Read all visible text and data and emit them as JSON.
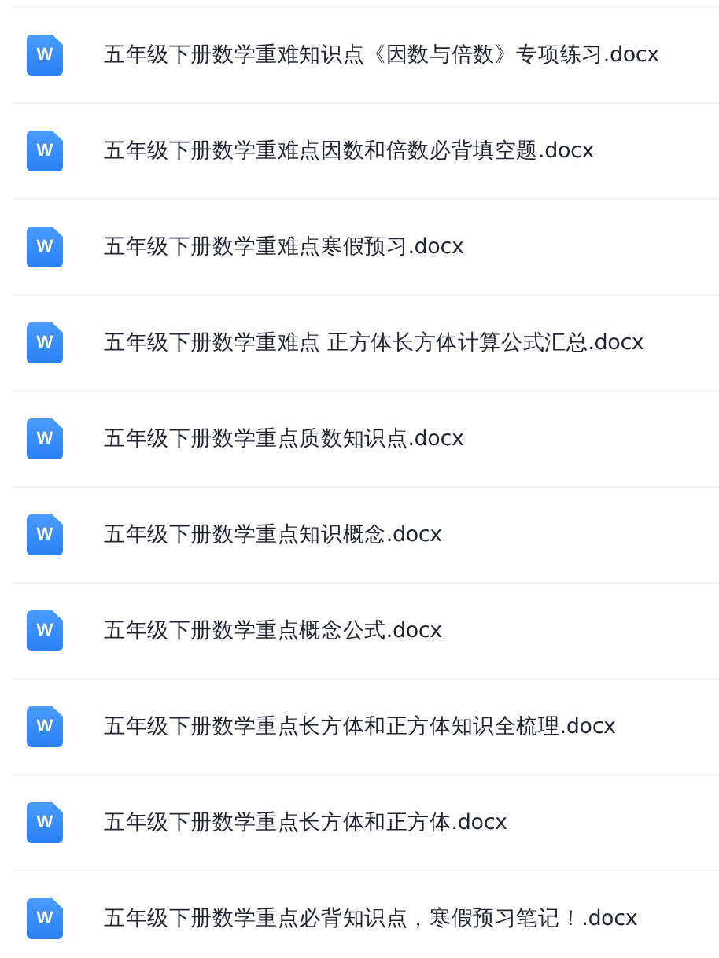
{
  "files": [
    {
      "name": "五年级下册数学重难知识点《因数与倍数》专项练习.docx",
      "icon_letter": "W"
    },
    {
      "name": "五年级下册数学重难点因数和倍数必背填空题.docx",
      "icon_letter": "W"
    },
    {
      "name": "五年级下册数学重难点寒假预习.docx",
      "icon_letter": "W"
    },
    {
      "name": "五年级下册数学重难点 正方体长方体计算公式汇总.docx",
      "icon_letter": "W"
    },
    {
      "name": "五年级下册数学重点质数知识点.docx",
      "icon_letter": "W"
    },
    {
      "name": "五年级下册数学重点知识概念.docx",
      "icon_letter": "W"
    },
    {
      "name": "五年级下册数学重点概念公式.docx",
      "icon_letter": "W"
    },
    {
      "name": "五年级下册数学重点长方体和正方体知识全梳理.docx",
      "icon_letter": "W"
    },
    {
      "name": "五年级下册数学重点长方体和正方体.docx",
      "icon_letter": "W"
    },
    {
      "name": "五年级下册数学重点必背知识点，寒假预习笔记！.docx",
      "icon_letter": "W"
    }
  ]
}
